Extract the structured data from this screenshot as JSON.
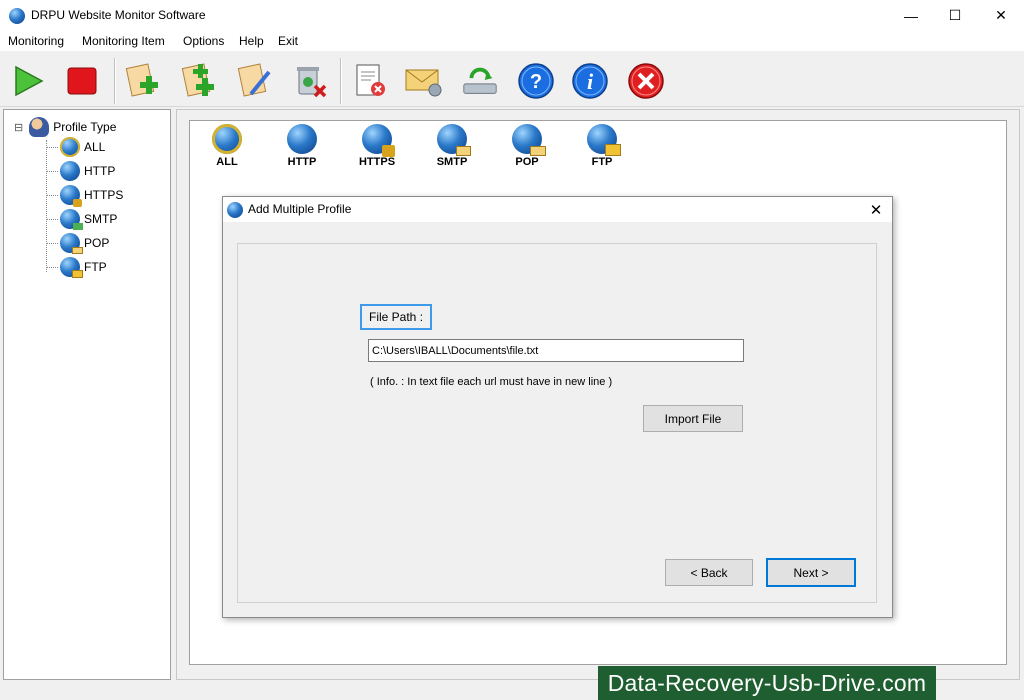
{
  "window": {
    "title": "DRPU Website Monitor Software",
    "controls": [
      "—",
      "☐",
      "✕"
    ]
  },
  "menu": [
    "Monitoring",
    "Monitoring Item",
    "Options",
    "Help",
    "Exit"
  ],
  "toolbar": {
    "icons": [
      "start-icon",
      "stop-icon",
      "add-profile-icon",
      "add-multiple-profile-icon",
      "edit-profile-icon",
      "delete-profile-icon",
      "report-icon",
      "email-settings-icon",
      "update-icon",
      "help-icon",
      "about-icon",
      "exit-icon"
    ]
  },
  "tree": {
    "root": "Profile Type",
    "collapse_glyph": "⊟",
    "items": [
      "ALL",
      "HTTP",
      "HTTPS",
      "SMTP",
      "POP",
      "FTP"
    ]
  },
  "protocols": [
    "ALL",
    "HTTP",
    "HTTPS",
    "SMTP",
    "POP",
    "FTP"
  ],
  "dialog": {
    "title": "Add Multiple Profile",
    "close": "✕",
    "file_path_label": "File Path :",
    "file_path_value": "C:\\Users\\IBALL\\Documents\\file.txt",
    "info": "( Info. : In text file each url must have in new line )",
    "import_button": "Import File",
    "back_button": "< Back",
    "next_button": "Next >"
  },
  "watermark": "Data-Recovery-Usb-Drive.com",
  "colors": {
    "accent": "#0078d7",
    "watermark_bg": "#1f5e30"
  }
}
